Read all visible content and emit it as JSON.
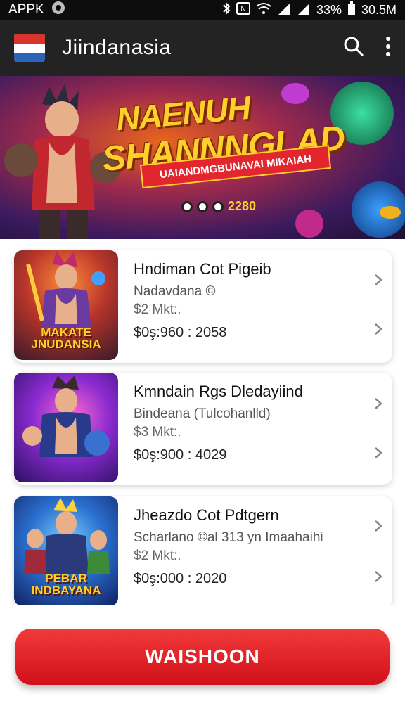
{
  "status_bar": {
    "carrier": "APPK",
    "battery": "33%",
    "data": "30.5M"
  },
  "app_bar": {
    "title": "Jiindanasia"
  },
  "banner": {
    "title_line1": "NAENUH",
    "title_line2": "SHANNNGLAD",
    "ribbon": "UAIANDMGBUNAVAI MIKAIAH",
    "coins": "2280"
  },
  "games": [
    {
      "title": "Hndiman Cot Pigeib",
      "subtitle": "Nadavdana ©",
      "price": "$2 Mkt:.",
      "meta": "$0ş:960 : 2058",
      "thumb_label": "MAKATE JNUDANSIA"
    },
    {
      "title": "Kmndain Rgs Dledayiind",
      "subtitle": "Bindeana (Tulcohanlld)",
      "price": "$3 Mkt:.",
      "meta": "$0ş:900 : 4029",
      "thumb_label": ""
    },
    {
      "title": "Jheazdo Cot Pdtgern",
      "subtitle": "Scharlano ©al 313 yn Imaahaihi",
      "price": "$2 Mkt:.",
      "meta": "$0ş:000 : 2020",
      "thumb_label": "PEBAR INDBAYANA"
    }
  ],
  "cta": {
    "label": "WAISHOON"
  },
  "colors": {
    "accent": "#e3262d",
    "appbar": "#232323",
    "gold": "#ffd02b"
  }
}
